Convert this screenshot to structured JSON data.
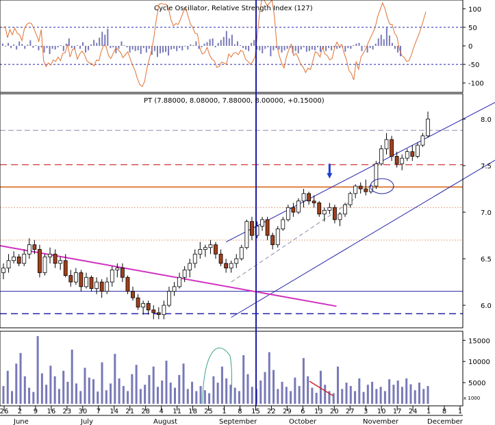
{
  "chart_data": {
    "type": "candlestick",
    "panels": {
      "oscillator": {
        "title": "Cycle Oscillator, Relative Strength Index (127)",
        "ylim": [
          -120,
          120
        ],
        "yticks": [
          100,
          50,
          0,
          -50,
          -100
        ],
        "levels": [
          50,
          -50
        ],
        "histogram": [
          6,
          -2,
          8,
          -6,
          4,
          -10,
          12,
          5,
          -8,
          3,
          15,
          -5,
          2,
          -12,
          -4,
          -18,
          -6,
          -22,
          -8,
          -10,
          -4,
          2,
          -14,
          6,
          20,
          -6,
          -10,
          2,
          -8,
          10,
          -18,
          -12,
          4,
          16,
          8,
          22,
          38,
          30,
          46,
          -6,
          -4,
          -20,
          -8,
          12,
          2,
          -4,
          -18,
          -10,
          -14,
          -12,
          -22,
          -6,
          -18,
          -8,
          -24,
          -14,
          -30,
          -20,
          -18,
          -16,
          -26,
          -10,
          -8,
          -14,
          -6,
          -12,
          -2,
          -10,
          4,
          2,
          12,
          -8,
          -4,
          6,
          10,
          18,
          20,
          -4,
          8,
          16,
          24,
          40,
          20,
          30,
          4,
          12,
          2,
          -6,
          -10,
          -14,
          8,
          16,
          -10,
          -12,
          -20,
          -8,
          -4,
          -28,
          -12,
          -6,
          -10,
          -18,
          -12,
          -8,
          -6,
          -20,
          -14,
          -20,
          -10,
          -4,
          -16,
          -14,
          -10,
          -12,
          -4,
          -16,
          -8,
          -14,
          -6,
          -12,
          -4,
          -8,
          -6,
          -4,
          -16,
          -6,
          -8,
          2,
          6,
          8,
          -14,
          -2,
          -18,
          -6,
          -10,
          6,
          20,
          30,
          18,
          52,
          28,
          8,
          -8,
          -18,
          -28
        ],
        "rsi_line": [
          48,
          52,
          22,
          44,
          30,
          48,
          34,
          30,
          14,
          46,
          58,
          62,
          60,
          46,
          30,
          12,
          44,
          -40,
          -56,
          -46,
          -52,
          -38,
          -42,
          -30,
          -40,
          -20,
          -18,
          4,
          -30,
          -10,
          -8,
          -36,
          -22,
          -14,
          -24,
          -40,
          -46,
          -48,
          -54,
          -38,
          -40,
          -14,
          2,
          -2,
          -26,
          -34,
          -20,
          -6,
          -10,
          -18,
          -32,
          -24,
          -16,
          -34,
          -52,
          -66,
          -88,
          -104,
          -110,
          -96,
          -60,
          -34,
          -10,
          28,
          76,
          112,
          114,
          112,
          112,
          98,
          70,
          54,
          60,
          58,
          72,
          90,
          104,
          82,
          60,
          50,
          34,
          32,
          -6,
          -22,
          -18,
          -4,
          -24,
          -36,
          -40,
          -58,
          -56,
          -44,
          -46,
          -50,
          -22,
          -30,
          -20,
          -18,
          -24,
          -12,
          -16,
          -36,
          -42,
          -50,
          -42,
          -28,
          36,
          96,
          132,
          120,
          108,
          116,
          124,
          80,
          2,
          -26,
          -46,
          -60,
          -30,
          -10,
          4,
          -26,
          -20,
          -34,
          -50,
          -58,
          -72,
          -60,
          -64,
          -40,
          -16,
          -20,
          -30,
          -4,
          -22,
          -26,
          -38,
          -34,
          -6,
          10,
          -2,
          4,
          -20,
          -38,
          -66,
          -74,
          -92,
          -42,
          -64,
          -30,
          -20,
          -8,
          8,
          22,
          36,
          52,
          80,
          98,
          116,
          100,
          76,
          58,
          58,
          34,
          24,
          -10,
          -26,
          -32,
          -42,
          -40,
          -24,
          -4,
          14,
          30,
          48,
          70,
          92
        ]
      },
      "price": {
        "title": "PT (7.88000, 8.08000, 7.88000, 8.00000, +0.15000)",
        "ylim": [
          5.78,
          8.25
        ],
        "yticks": [
          8.0,
          7.5,
          7.0,
          6.5,
          6.0
        ],
        "ohlc": [
          [
            6.35,
            6.45,
            6.28,
            6.4
          ],
          [
            6.4,
            6.55,
            6.35,
            6.48
          ],
          [
            6.48,
            6.58,
            6.45,
            6.52
          ],
          [
            6.52,
            6.55,
            6.42,
            6.45
          ],
          [
            6.45,
            6.6,
            6.42,
            6.55
          ],
          [
            6.55,
            6.72,
            6.5,
            6.65
          ],
          [
            6.65,
            6.7,
            6.55,
            6.6
          ],
          [
            6.6,
            6.65,
            6.3,
            6.35
          ],
          [
            6.35,
            6.55,
            6.32,
            6.52
          ],
          [
            6.52,
            6.62,
            6.45,
            6.55
          ],
          [
            6.55,
            6.6,
            6.4,
            6.45
          ],
          [
            6.45,
            6.52,
            6.38,
            6.48
          ],
          [
            6.48,
            6.55,
            6.3,
            6.32
          ],
          [
            6.32,
            6.38,
            6.2,
            6.25
          ],
          [
            6.25,
            6.4,
            6.22,
            6.35
          ],
          [
            6.35,
            6.38,
            6.15,
            6.2
          ],
          [
            6.2,
            6.35,
            6.18,
            6.3
          ],
          [
            6.3,
            6.32,
            6.15,
            6.18
          ],
          [
            6.18,
            6.3,
            6.12,
            6.25
          ],
          [
            6.25,
            6.28,
            6.08,
            6.15
          ],
          [
            6.15,
            6.3,
            6.12,
            6.25
          ],
          [
            6.25,
            6.42,
            6.2,
            6.38
          ],
          [
            6.38,
            6.45,
            6.3,
            6.4
          ],
          [
            6.4,
            6.45,
            6.25,
            6.3
          ],
          [
            6.3,
            6.32,
            6.12,
            6.15
          ],
          [
            6.15,
            6.2,
            6.05,
            6.08
          ],
          [
            6.08,
            6.12,
            5.95,
            5.98
          ],
          [
            5.98,
            6.05,
            5.9,
            6.02
          ],
          [
            6.02,
            6.05,
            5.9,
            5.95
          ],
          [
            5.95,
            6.0,
            5.85,
            5.92
          ],
          [
            5.92,
            5.98,
            5.85,
            5.9
          ],
          [
            5.9,
            6.05,
            5.85,
            6.0
          ],
          [
            6.0,
            6.2,
            5.98,
            6.15
          ],
          [
            6.15,
            6.25,
            6.1,
            6.2
          ],
          [
            6.2,
            6.35,
            6.18,
            6.3
          ],
          [
            6.3,
            6.42,
            6.25,
            6.38
          ],
          [
            6.38,
            6.5,
            6.3,
            6.45
          ],
          [
            6.45,
            6.6,
            6.4,
            6.55
          ],
          [
            6.55,
            6.68,
            6.5,
            6.6
          ],
          [
            6.6,
            6.65,
            6.52,
            6.62
          ],
          [
            6.62,
            6.7,
            6.55,
            6.65
          ],
          [
            6.65,
            6.68,
            6.5,
            6.55
          ],
          [
            6.55,
            6.6,
            6.42,
            6.45
          ],
          [
            6.45,
            6.5,
            6.35,
            6.4
          ],
          [
            6.4,
            6.48,
            6.35,
            6.45
          ],
          [
            6.45,
            6.55,
            6.4,
            6.5
          ],
          [
            6.5,
            6.65,
            6.48,
            6.62
          ],
          [
            6.62,
            6.92,
            6.6,
            6.9
          ],
          [
            6.9,
            6.95,
            6.7,
            6.75
          ],
          [
            6.75,
            6.9,
            6.72,
            6.85
          ],
          [
            6.85,
            6.95,
            6.8,
            6.92
          ],
          [
            6.92,
            6.95,
            6.7,
            6.75
          ],
          [
            6.75,
            6.78,
            6.6,
            6.65
          ],
          [
            6.65,
            6.85,
            6.62,
            6.82
          ],
          [
            6.82,
            6.95,
            6.8,
            6.92
          ],
          [
            6.92,
            7.08,
            6.9,
            7.05
          ],
          [
            7.05,
            7.1,
            6.95,
            7.0
          ],
          [
            7.0,
            7.15,
            6.98,
            7.12
          ],
          [
            7.12,
            7.25,
            7.05,
            7.2
          ],
          [
            7.2,
            7.22,
            7.08,
            7.12
          ],
          [
            7.12,
            7.18,
            7.05,
            7.1
          ],
          [
            7.1,
            7.12,
            6.95,
            6.98
          ],
          [
            6.98,
            7.05,
            6.9,
            7.02
          ],
          [
            7.02,
            7.1,
            6.98,
            7.05
          ],
          [
            7.05,
            7.08,
            6.88,
            6.92
          ],
          [
            6.92,
            7.0,
            6.85,
            6.98
          ],
          [
            6.98,
            7.1,
            6.95,
            7.08
          ],
          [
            7.08,
            7.22,
            7.05,
            7.2
          ],
          [
            7.2,
            7.3,
            7.15,
            7.28
          ],
          [
            7.28,
            7.32,
            7.2,
            7.25
          ],
          [
            7.25,
            7.35,
            7.18,
            7.22
          ],
          [
            7.22,
            7.3,
            7.2,
            7.28
          ],
          [
            7.28,
            7.55,
            7.25,
            7.52
          ],
          [
            7.52,
            7.72,
            7.5,
            7.68
          ],
          [
            7.68,
            7.85,
            7.62,
            7.78
          ],
          [
            7.78,
            7.82,
            7.55,
            7.6
          ],
          [
            7.6,
            7.65,
            7.48,
            7.52
          ],
          [
            7.52,
            7.62,
            7.45,
            7.58
          ],
          [
            7.58,
            7.68,
            7.55,
            7.65
          ],
          [
            7.65,
            7.72,
            7.55,
            7.6
          ],
          [
            7.6,
            7.75,
            7.58,
            7.72
          ],
          [
            7.72,
            7.85,
            7.7,
            7.82
          ],
          [
            7.82,
            8.08,
            7.8,
            8.0
          ]
        ],
        "horizontal_levels": [
          7.88,
          7.51,
          7.27,
          6.15,
          5.91
        ],
        "channel": {
          "upper": [
            [
              43,
              6.68
            ],
            [
              95,
              8.18
            ]
          ],
          "lower": [
            [
              44,
              5.87
            ],
            [
              95,
              7.56
            ]
          ]
        },
        "downtrend_line": [
          [
            0,
            6.64
          ],
          [
            65,
            5.99
          ]
        ]
      },
      "volume": {
        "unit": "x 1000",
        "ylim": [
          0,
          16500
        ],
        "yticks": [
          15000,
          10000,
          5000
        ],
        "values": [
          4200,
          7800,
          3000,
          9500,
          12000,
          6500,
          3800,
          2800,
          16000,
          7200,
          4500,
          9000,
          6500,
          3500,
          7800,
          5200,
          12800,
          4800,
          3000,
          8500,
          6200,
          5800,
          2900,
          9800,
          3200,
          4800,
          11800,
          6000,
          4200,
          3000,
          7000,
          9200,
          3500,
          4500,
          6800,
          8800,
          4000,
          5500,
          10200,
          5000,
          3800,
          6800,
          9500,
          3500,
          5200,
          3000,
          4200,
          3200,
          2500,
          6500,
          5000,
          8800,
          6000,
          4500,
          3800,
          3000,
          11500,
          7000,
          4000,
          3500,
          5500,
          7500,
          12200,
          8000,
          3500,
          5200,
          4000,
          3000,
          6200,
          4200,
          10800,
          6500,
          3800,
          2600,
          7800,
          4500,
          3000,
          2500,
          8800,
          3500,
          5000,
          4200,
          3000,
          6000,
          2800,
          4500,
          5200,
          3500,
          4000,
          3000,
          5800,
          4500,
          5500,
          4000,
          6000,
          4600,
          3200,
          5000,
          3500,
          4200
        ]
      }
    },
    "x_labels": [
      "26",
      "2",
      "9",
      "16",
      "23",
      "30",
      "7",
      "14",
      "21",
      "28",
      "4",
      "11",
      "18",
      "25",
      "1",
      "8",
      "15",
      "22",
      "29",
      "6",
      "13",
      "20",
      "27",
      "3",
      "10",
      "17",
      "24",
      "1",
      "8",
      "1"
    ],
    "month_labels": [
      "June",
      "July",
      "August",
      "September",
      "October",
      "November",
      "December"
    ]
  }
}
